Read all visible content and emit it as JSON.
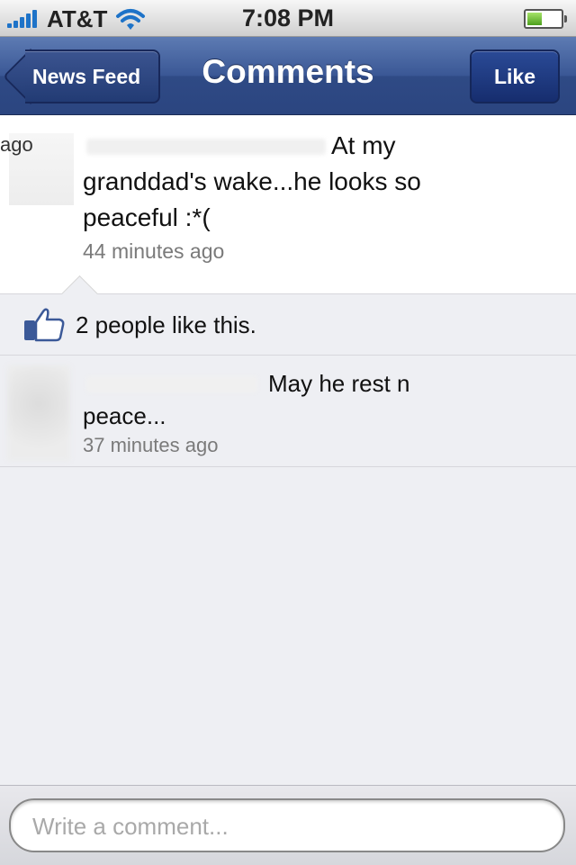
{
  "status_bar": {
    "carrier": "AT&T",
    "time": "7:08 PM"
  },
  "nav": {
    "back_label": "News Feed",
    "title": "Comments",
    "like_label": "Like"
  },
  "post": {
    "ago_fragment": "ago",
    "text": "At my granddad's wake...he looks so peaceful :*(",
    "time": "44 minutes ago"
  },
  "likes": {
    "text": "2 people like this."
  },
  "comments": [
    {
      "text": "May he rest n peace...",
      "time": "37 minutes ago"
    }
  ],
  "composer": {
    "placeholder": "Write a comment..."
  },
  "colors": {
    "nav_blue": "#3a5795",
    "background": "#eeeff3",
    "timestamp_gray": "#7a7a7a",
    "signal_blue": "#1e73c8"
  }
}
